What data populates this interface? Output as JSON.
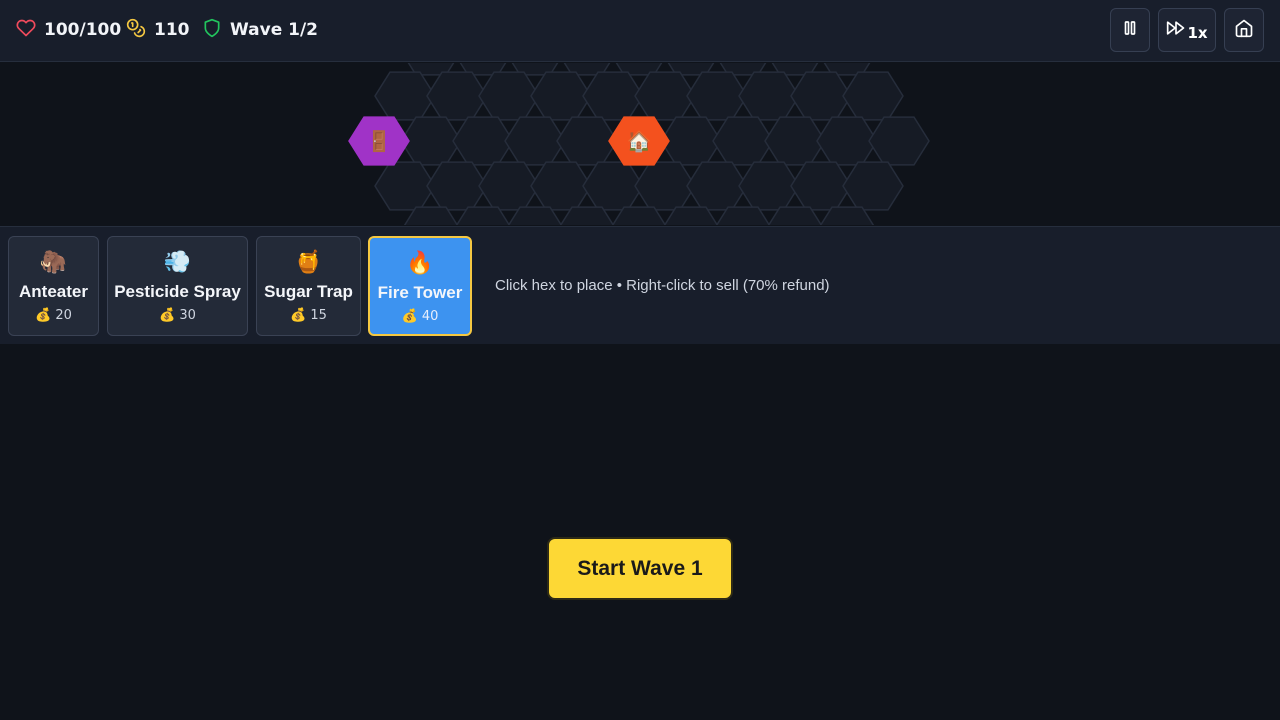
{
  "hud": {
    "lives": "100/100",
    "gold": "110",
    "wave": "Wave 1/2",
    "speed": "1x",
    "icons": {
      "lives": "heart-icon",
      "gold": "coins-icon",
      "wave": "shield-icon"
    },
    "colors": {
      "lives": "#ef4a5c",
      "gold": "#f5c842",
      "wave": "#22c55e"
    }
  },
  "map": {
    "spawn_icon": "🚪",
    "base_icon": "🏠",
    "spawn_color": "#a033c7",
    "base_color": "#f4511e",
    "hex_fill": "#161b25",
    "hex_stroke": "#262d3b"
  },
  "shop": {
    "towers": [
      {
        "icon": "🦣",
        "name": "Anteater",
        "cost": "💰 20"
      },
      {
        "icon": "💨",
        "name": "Pesticide Spray",
        "cost": "💰 30"
      },
      {
        "icon": "🍯",
        "name": "Sugar Trap",
        "cost": "💰 15"
      },
      {
        "icon": "🔥",
        "name": "Fire Tower",
        "cost": "💰 40"
      }
    ],
    "selected": "Fire Tower",
    "hint": "Click hex to place • Right-click to sell (70% refund)",
    "selected_color": "#3d93f0",
    "selected_border": "#f5c842"
  },
  "start_button": {
    "label": "Start Wave 1",
    "color": "#fdd835"
  }
}
